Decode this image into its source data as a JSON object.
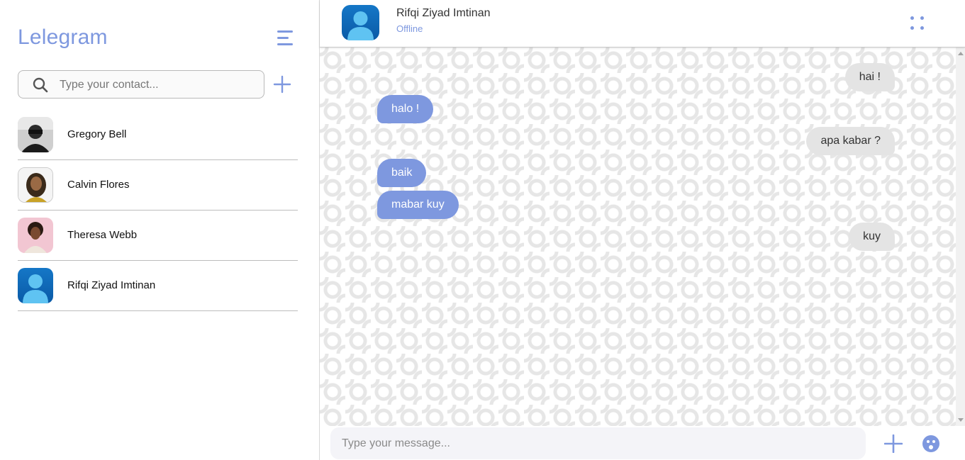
{
  "app": {
    "brand": "Lelegram"
  },
  "search": {
    "placeholder": "Type your contact..."
  },
  "contacts": [
    {
      "name": "Gregory Bell",
      "avatar": "photo-avatar"
    },
    {
      "name": "Calvin Flores",
      "avatar": "photo-avatar"
    },
    {
      "name": "Theresa Webb",
      "avatar": "photo-avatar"
    },
    {
      "name": "Rifqi Ziyad Imtinan",
      "avatar": "default-user-avatar"
    }
  ],
  "chat": {
    "name": "Rifqi Ziyad Imtinan",
    "status": "Offline",
    "messages": [
      {
        "text": "hai !",
        "direction": "outgoing"
      },
      {
        "text": "halo !",
        "direction": "incoming"
      },
      {
        "text": "apa kabar ?",
        "direction": "outgoing"
      },
      {
        "text": "baik",
        "direction": "incoming"
      },
      {
        "text": "mabar kuy",
        "direction": "incoming"
      },
      {
        "text": "kuy",
        "direction": "outgoing"
      }
    ]
  },
  "composer": {
    "placeholder": "Type your message..."
  },
  "colors": {
    "accent": "#7e98df",
    "outgoing_bubble": "#e4e4e4",
    "incoming_bubble": "#7e98df"
  },
  "icons": [
    "menu-icon",
    "search-icon",
    "plus-icon",
    "more-dots-icon",
    "emoji-icon"
  ]
}
